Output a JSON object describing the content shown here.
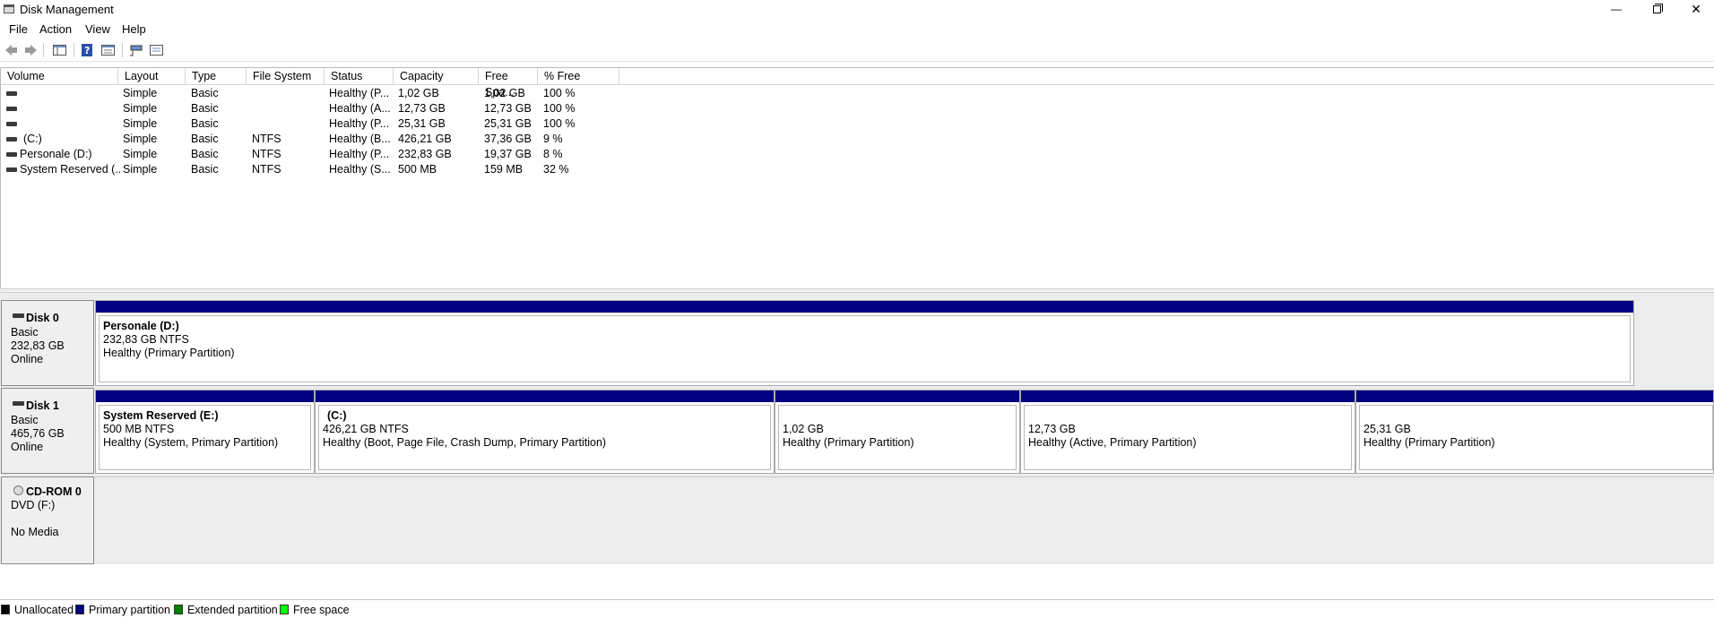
{
  "window": {
    "title": "Disk Management",
    "minimize_glyph": "—",
    "close_glyph": "✕"
  },
  "menu": [
    "File",
    "Action",
    "View",
    "Help"
  ],
  "toolbar_icons": [
    "back-arrow-icon",
    "forward-arrow-icon",
    "console-tree-icon",
    "help-icon",
    "properties-icon",
    "rescan-disks-icon",
    "disk-list-icon"
  ],
  "table": {
    "headers": [
      "Volume",
      "Layout",
      "Type",
      "File System",
      "Status",
      "Capacity",
      "Free Spa...",
      "% Free"
    ],
    "rows": [
      [
        "",
        "Simple",
        "Basic",
        "",
        "Healthy (P...",
        "1,02 GB",
        "1,02 GB",
        "100 %"
      ],
      [
        "",
        "Simple",
        "Basic",
        "",
        "Healthy (A...",
        "12,73 GB",
        "12,73 GB",
        "100 %"
      ],
      [
        "",
        "Simple",
        "Basic",
        "",
        "Healthy (P...",
        "25,31 GB",
        "25,31 GB",
        "100 %"
      ],
      [
        "(C:)",
        "Simple",
        "Basic",
        "NTFS",
        "Healthy (B...",
        "426,21 GB",
        "37,36 GB",
        "9 %"
      ],
      [
        "Personale (D:)",
        "Simple",
        "Basic",
        "NTFS",
        "Healthy (P...",
        "232,83 GB",
        "19,37 GB",
        "8 %"
      ],
      [
        "System Reserved (...",
        "Simple",
        "Basic",
        "NTFS",
        "Healthy (S...",
        "500 MB",
        "159 MB",
        "32 %"
      ]
    ]
  },
  "disks": [
    {
      "name": "Disk 0",
      "type": "Basic",
      "size": "232,83 GB",
      "status": "Online",
      "partitions": [
        {
          "name": "Personale  (D:)",
          "size": "232,83 GB NTFS",
          "status": "Healthy (Primary Partition)"
        }
      ]
    },
    {
      "name": "Disk 1",
      "type": "Basic",
      "size": "465,76 GB",
      "status": "Online",
      "partitions": [
        {
          "name": "System Reserved  (E:)",
          "size": "500 MB NTFS",
          "status": "Healthy (System, Primary Partition)"
        },
        {
          "name": "(C:)",
          "size": "426,21 GB NTFS",
          "status": "Healthy (Boot, Page File, Crash Dump, Primary Partition)"
        },
        {
          "name": "",
          "size": "1,02 GB",
          "status": "Healthy (Primary Partition)"
        },
        {
          "name": "",
          "size": "12,73 GB",
          "status": "Healthy (Active, Primary Partition)"
        },
        {
          "name": "",
          "size": "25,31 GB",
          "status": "Healthy (Primary Partition)"
        }
      ]
    },
    {
      "name": "CD-ROM 0",
      "type": "DVD (F:)",
      "size": "",
      "status": "No Media",
      "partitions": []
    }
  ],
  "legend": [
    {
      "label": "Unallocated",
      "color": "#000000"
    },
    {
      "label": "Primary partition",
      "color": "#000080"
    },
    {
      "label": "Extended partition",
      "color": "#008000"
    },
    {
      "label": "Free space",
      "color": "#00ff00"
    }
  ],
  "colors": {
    "primary_partition_bar": "#000080"
  }
}
